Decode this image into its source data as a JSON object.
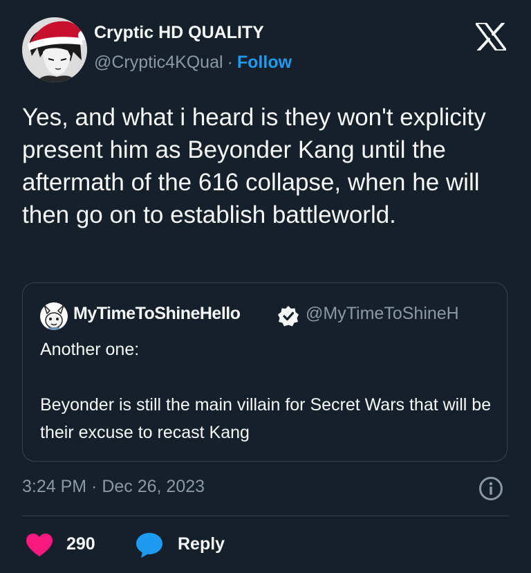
{
  "author": {
    "display_name": "Cryptic HD QUALITY",
    "handle": "@Cryptic4KQual",
    "separator": "·",
    "follow_label": "Follow"
  },
  "tweet": {
    "text": "Yes, and what i heard is they won't explicity present him as Beyonder Kang until the aftermath of the 616 collapse, when he will then go on to establish battleworld."
  },
  "quoted_tweet": {
    "display_name": "MyTimeToShineHello",
    "handle": "@MyTimeToShineH",
    "verified": true,
    "text": "Another one:\n\nBeyonder is still the main villain for Secret Wars that will be their excuse to recast Kang"
  },
  "meta": {
    "timestamp": "3:24 PM · Dec 26, 2023"
  },
  "actions": {
    "like_count": "290",
    "reply_label": "Reply"
  },
  "icons": {
    "brand": "x-logo-icon",
    "info": "info-icon",
    "like": "heart-icon",
    "reply": "speech-bubble-icon",
    "verified": "verified-badge-icon"
  },
  "colors": {
    "background": "#15202b",
    "text": "#f7f9f9",
    "secondary": "#8b98a5",
    "accent": "#1d9bf0",
    "like": "#f91880",
    "border": "#38444d"
  }
}
